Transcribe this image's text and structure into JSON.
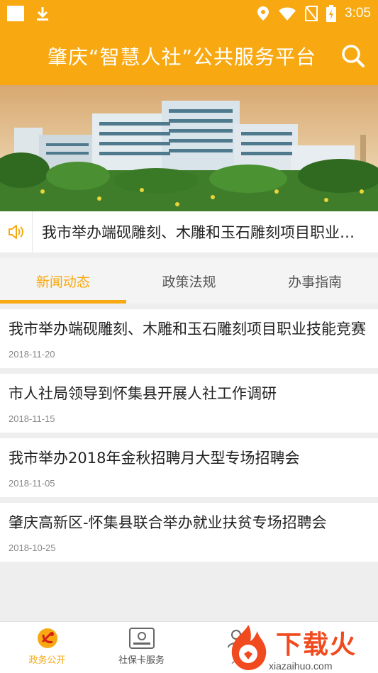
{
  "status_bar": {
    "time": "3:05"
  },
  "header": {
    "title": "肇庆“智慧人社”公共服务平台"
  },
  "notice": {
    "text": "我市举办端砚雕刻、木雕和玉石雕刻项目职业技能竞赛"
  },
  "tabs": [
    {
      "label": "新闻动态",
      "active": true
    },
    {
      "label": "政策法规",
      "active": false
    },
    {
      "label": "办事指南",
      "active": false
    }
  ],
  "news": [
    {
      "title": "我市举办端砚雕刻、木雕和玉石雕刻项目职业技能竞赛",
      "date": "2018-11-20"
    },
    {
      "title": "市人社局领导到怀集县开展人社工作调研",
      "date": "2018-11-15"
    },
    {
      "title": "我市举办2018年金秋招聘月大型专场招聘会",
      "date": "2018-11-05"
    },
    {
      "title": "肇庆高新区-怀集县联合举办就业扶贫专场招聘会",
      "date": "2018-10-25"
    }
  ],
  "bottom_nav": [
    {
      "label": "政务公开",
      "icon": "party-emblem-icon",
      "active": true
    },
    {
      "label": "社保卡服务",
      "icon": "social-security-card-icon",
      "active": false
    },
    {
      "label": "人",
      "icon": "person-icon",
      "active": false
    }
  ],
  "watermark": {
    "text": "下载火",
    "url": "xiazaihuo.com"
  },
  "colors": {
    "accent": "#f8a912",
    "watermark": "#f04a1e"
  }
}
